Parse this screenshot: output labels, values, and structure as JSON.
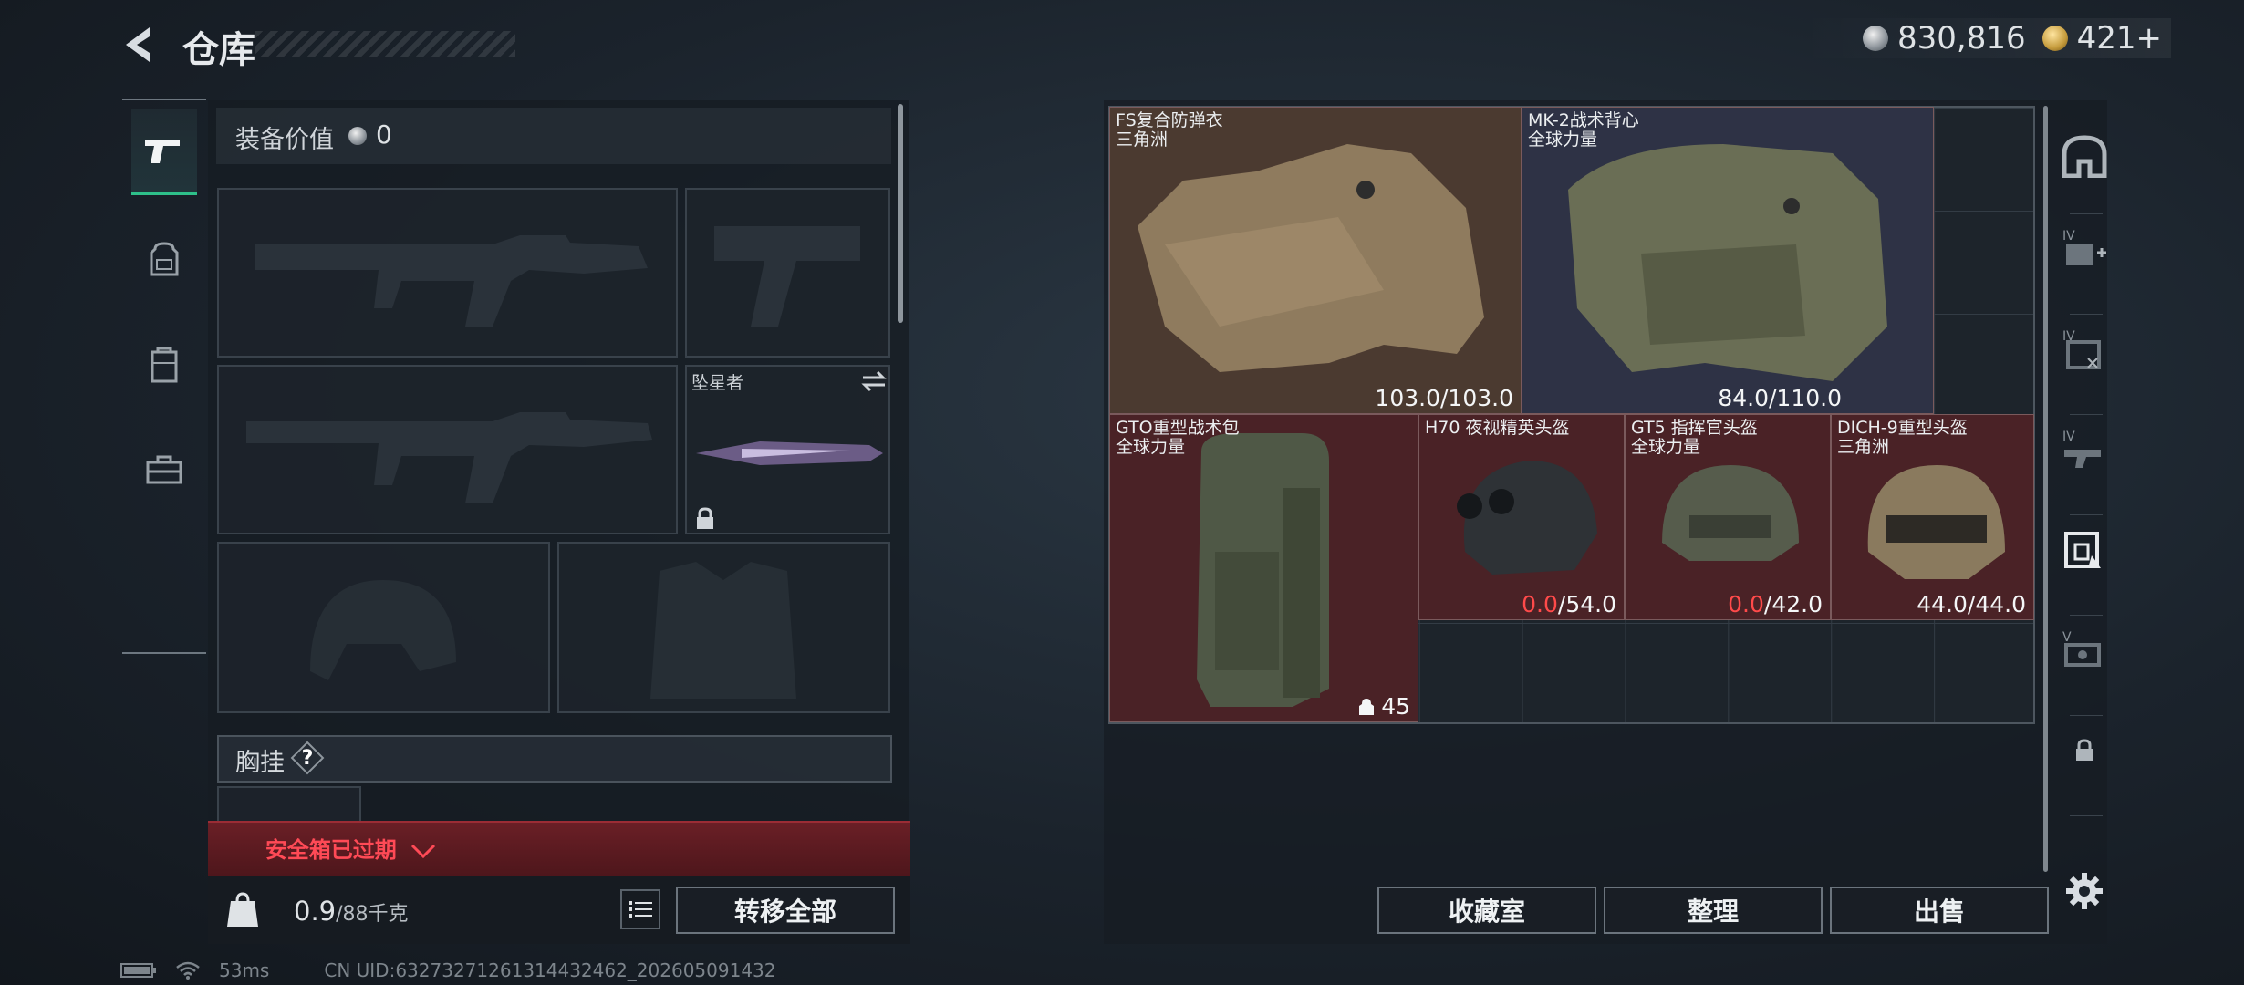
{
  "header": {
    "title": "仓库",
    "currency": [
      {
        "icon": "silver-coin-icon",
        "value": "830,816"
      },
      {
        "icon": "gold-coin-icon",
        "value": "421+"
      }
    ]
  },
  "left_nav": [
    {
      "icon": "pistol-icon",
      "active": true
    },
    {
      "icon": "backpack-icon",
      "active": false
    },
    {
      "icon": "chest-rig-icon",
      "active": false
    },
    {
      "icon": "toolbox-icon",
      "active": false
    }
  ],
  "loadout": {
    "equipment_value_label": "装备价值",
    "equipment_value": "0",
    "melee_name": "坠星者",
    "chest_rig_label": "胸挂",
    "help": "?",
    "secure_box_status": "安全箱已过期",
    "weight_current": "0.9",
    "weight_max": "/88千克",
    "transfer_all_label": "转移全部"
  },
  "stash": {
    "items": [
      {
        "name_line1": "FS复合防弹衣",
        "name_line2": "三角洲",
        "dur_current": "103.0",
        "dur_max": "/103.0",
        "current_depleted": false,
        "icon": "body-armor-icon"
      },
      {
        "name_line1": "MK-2战术背心",
        "name_line2": "全球力量",
        "dur_current": "84.0",
        "dur_max": "/110.0",
        "current_depleted": false,
        "icon": "tactical-vest-icon"
      },
      {
        "name_line1": "GTO重型战术包",
        "name_line2": "全球力量",
        "capacity": "45",
        "icon": "heavy-backpack-icon"
      },
      {
        "name_line1": "H70 夜视精英头盔",
        "name_line2": "",
        "dur_current": "0.0",
        "dur_max": "/54.0",
        "current_depleted": true,
        "icon": "night-vision-helmet-icon"
      },
      {
        "name_line1": "GT5 指挥官头盔",
        "name_line2": "全球力量",
        "dur_current": "0.0",
        "dur_max": "/42.0",
        "current_depleted": true,
        "icon": "commander-helmet-icon"
      },
      {
        "name_line1": "DICH-9重型头盔",
        "name_line2": "三角洲",
        "dur_current": "44.0",
        "dur_max": "/44.0",
        "current_depleted": false,
        "icon": "heavy-helmet-icon"
      }
    ],
    "buttons": {
      "collection": "收藏室",
      "sort": "整理",
      "sell": "出售"
    }
  },
  "right_nav": [
    {
      "icon": "stash-home-icon"
    },
    {
      "icon": "medkit-tier4-icon"
    },
    {
      "icon": "armor-tier4-icon"
    },
    {
      "icon": "weapon-tier4-icon"
    },
    {
      "icon": "vest-tier4-icon"
    },
    {
      "icon": "item-tier5-icon"
    },
    {
      "icon": "lock-icon"
    },
    {
      "icon": "settings-gear-icon"
    }
  ],
  "status_bar": {
    "ping": "53ms",
    "uid": "CN UID:63273271261314432462_202605091432"
  },
  "colors": {
    "accent_green": "#2ec08a",
    "alert_red": "#ff4a56",
    "item_red_bg": "#4a2226"
  }
}
